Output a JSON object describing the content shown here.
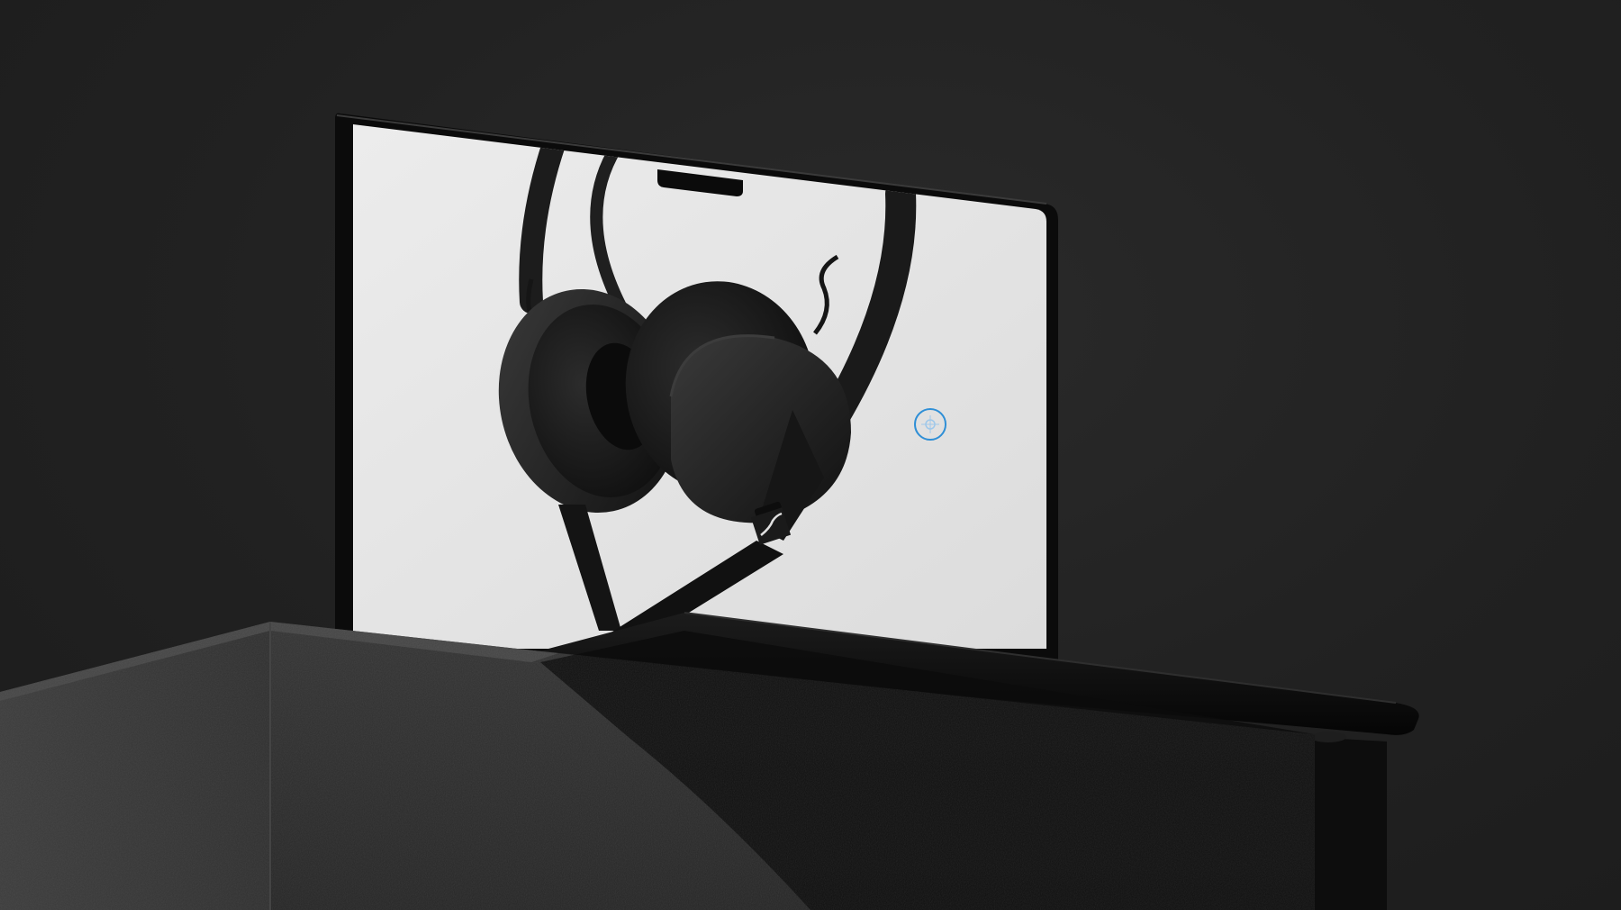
{
  "scene": {
    "description_label": "",
    "colors": {
      "background": "#222222",
      "screen": "#e4e4e4",
      "headphone": "#1a1a1a",
      "pedestal_top": "#3a3a3a",
      "pedestal_front": "#2e2e2e",
      "accent_ring": "#2f8fd6"
    },
    "laptop": {
      "brand_logo_icon": "sennheiser-logo-icon"
    },
    "hotspot": {
      "icon": "crosshair-hotspot-icon"
    }
  }
}
